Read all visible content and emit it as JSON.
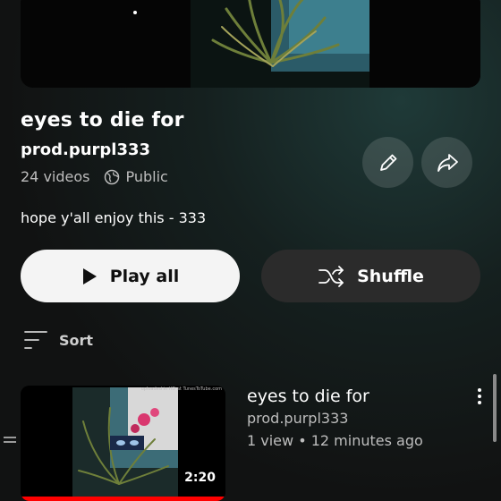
{
  "playlist": {
    "title": "eyes to die for",
    "owner": "prod.purpl333",
    "video_count": "24 videos",
    "visibility": "Public",
    "description": "hope y'all enjoy this - 333"
  },
  "actions": {
    "play_all_label": "Play all",
    "shuffle_label": "Shuffle"
  },
  "sort": {
    "label": "Sort"
  },
  "video": {
    "title": "eyes to die for",
    "owner": "prod.purpl333",
    "stats": "1 view • 12 minutes ago",
    "duration": "2:20",
    "watch_progress": 1.0,
    "watermark": "uploaded in HD at TunesToTube.com"
  },
  "icons": {
    "edit": "pencil-icon",
    "share": "share-icon",
    "globe": "globe-icon",
    "play": "play-icon",
    "shuffle": "shuffle-icon",
    "sort": "sort-icon",
    "more": "more-vertical-icon"
  },
  "colors": {
    "accent_red": "#ff0000",
    "play_button_bg": "#f4f4f4",
    "secondary_button_bg": "#2b2b2b"
  }
}
